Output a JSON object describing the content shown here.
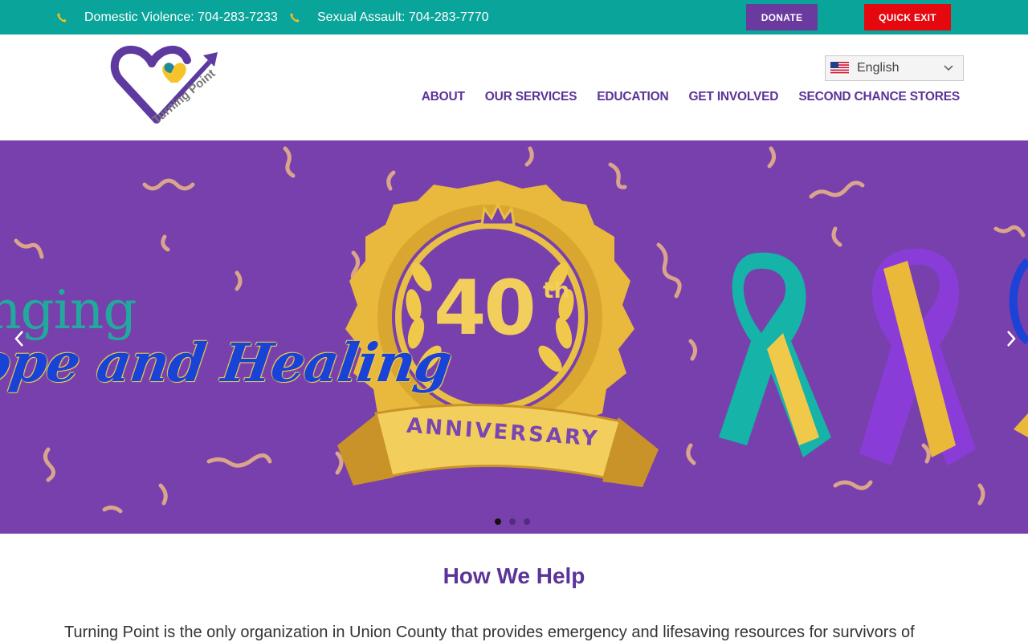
{
  "topbar": {
    "contacts": [
      {
        "label": "Domestic Violence: 704-283-7233",
        "icon": "phone-icon"
      },
      {
        "label": "Sexual Assault: 704-283-7770",
        "icon": "phone-icon"
      }
    ],
    "donate_label": "DONATE",
    "quick_exit_label": "QUICK EXIT",
    "colors": {
      "bar": "#0aa59a",
      "donate": "#6a3a9f",
      "quick_exit": "#e5080f"
    }
  },
  "header": {
    "logo_text": "Turning Point",
    "language": {
      "selected": "English",
      "icon": "us-flag-icon"
    },
    "nav": [
      "ABOUT",
      "OUR SERVICES",
      "EDUCATION",
      "GET INVOLVED",
      "SECOND CHANCE STORES"
    ],
    "nav_color": "#5b3399"
  },
  "hero": {
    "text_line_1": "nging",
    "text_line_2": "ope and Healing",
    "badge_number": "40",
    "badge_suffix": "th",
    "badge_banner": "ANNIVERSARY",
    "background": "#7840ac",
    "slides": 3,
    "active_slide": 1
  },
  "main": {
    "title": "How We Help",
    "intro": "Turning Point is the only organization in Union County that provides emergency and lifesaving resources for survivors of"
  }
}
